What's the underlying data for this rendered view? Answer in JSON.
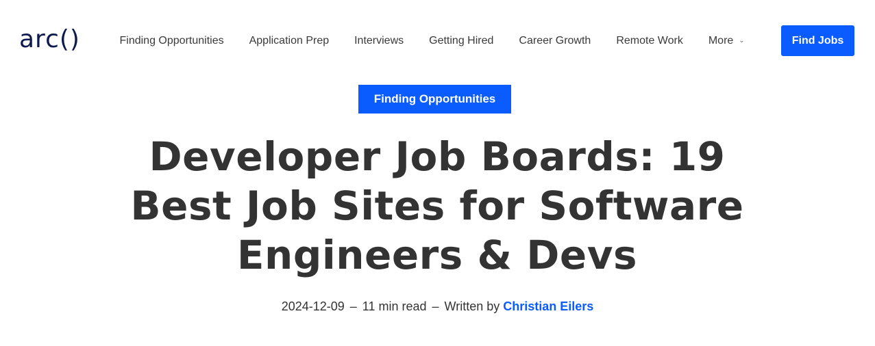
{
  "header": {
    "logo_text": "arc()",
    "nav": [
      {
        "label": "Finding Opportunities"
      },
      {
        "label": "Application Prep"
      },
      {
        "label": "Interviews"
      },
      {
        "label": "Getting Hired"
      },
      {
        "label": "Career Growth"
      },
      {
        "label": "Remote Work"
      },
      {
        "label": "More"
      }
    ],
    "more_icon": "chevron-down-icon",
    "cta_label": "Find Jobs"
  },
  "article": {
    "category": "Finding Opportunities",
    "title_line1": "Developer Job Boards: 19",
    "title_line2": "Best Job Sites for Software",
    "title_line3": "Engineers & Devs",
    "date": "2024-12-09",
    "separator": "–",
    "read_time": "11 min read",
    "written_by": "Written by",
    "author": "Christian Eilers"
  },
  "colors": {
    "accent": "#0a5cff",
    "logo": "#0d1a4f",
    "text": "#333333"
  }
}
